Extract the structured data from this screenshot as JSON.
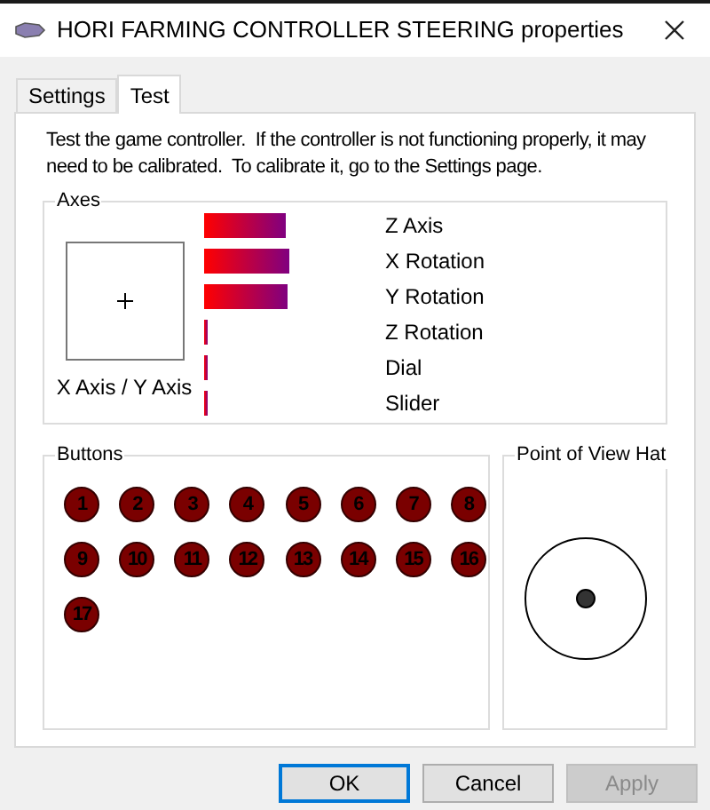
{
  "window": {
    "title": "HORI FARMING CONTROLLER STEERING properties"
  },
  "tabs": [
    {
      "label": "Settings",
      "selected": false
    },
    {
      "label": "Test",
      "selected": true
    }
  ],
  "intro": "Test the game controller.  If the controller is not functioning properly, it may need to be calibrated.  To calibrate it, go to the Settings page.",
  "axes": {
    "title": "Axes",
    "xy_label": "X Axis / Y Axis",
    "channels": [
      {
        "name": "Z Axis"
      },
      {
        "name": "X Rotation"
      },
      {
        "name": "Y Rotation"
      },
      {
        "name": "Z Rotation"
      },
      {
        "name": "Dial"
      },
      {
        "name": "Slider"
      }
    ]
  },
  "buttons_group": {
    "title": "Buttons",
    "items": [
      {
        "label": "1",
        "pressed": false
      },
      {
        "label": "2",
        "pressed": false
      },
      {
        "label": "3",
        "pressed": false
      },
      {
        "label": "4",
        "pressed": false
      },
      {
        "label": "5",
        "pressed": false
      },
      {
        "label": "6",
        "pressed": false
      },
      {
        "label": "7",
        "pressed": false
      },
      {
        "label": "8",
        "pressed": false
      },
      {
        "label": "9",
        "pressed": false
      },
      {
        "label": "10",
        "pressed": false
      },
      {
        "label": "11",
        "pressed": false
      },
      {
        "label": "12",
        "pressed": false
      },
      {
        "label": "13",
        "pressed": false
      },
      {
        "label": "14",
        "pressed": false
      },
      {
        "label": "15",
        "pressed": false
      },
      {
        "label": "16",
        "pressed": false
      },
      {
        "label": "17",
        "pressed": false
      }
    ]
  },
  "pov": {
    "title": "Point of View Hat"
  },
  "dialog_buttons": [
    {
      "label": "OK",
      "kind": "default",
      "disabled": false
    },
    {
      "label": "Cancel",
      "kind": "normal",
      "disabled": false
    },
    {
      "label": "Apply",
      "kind": "normal",
      "disabled": true
    }
  ]
}
